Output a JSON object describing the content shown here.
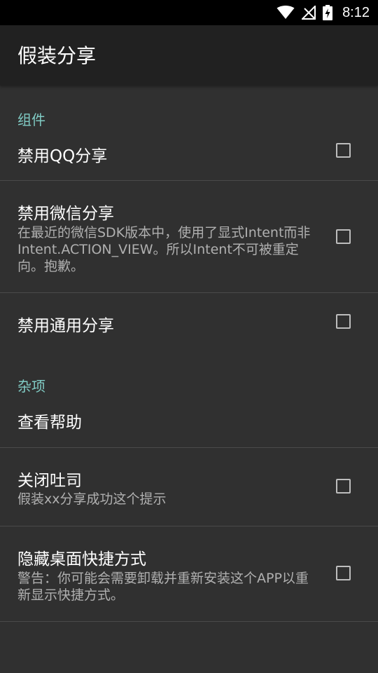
{
  "status_bar": {
    "time": "8:12",
    "icons": [
      "wifi-icon",
      "no-signal-icon",
      "battery-charging-icon"
    ]
  },
  "toolbar": {
    "title": "假装分享"
  },
  "colors": {
    "background": "#303030",
    "toolbar": "#212121",
    "accent": "#80cbc4",
    "divider": "#4a4a4a"
  },
  "categories": [
    {
      "title": "组件",
      "items": [
        {
          "title": "禁用QQ分享",
          "summary": "",
          "checkbox": true,
          "checked": false
        },
        {
          "title": "禁用微信分享",
          "summary": "在最近的微信SDK版本中，使用了显式Intent而非Intent.ACTION_VIEW。所以Intent不可被重定向。抱歉。",
          "checkbox": true,
          "checked": false
        },
        {
          "title": "禁用通用分享",
          "summary": "",
          "checkbox": true,
          "checked": false
        }
      ]
    },
    {
      "title": "杂项",
      "items": [
        {
          "title": "查看帮助",
          "summary": "",
          "checkbox": false
        },
        {
          "title": "关闭吐司",
          "summary": "假装xx分享成功这个提示",
          "checkbox": true,
          "checked": false
        },
        {
          "title": "隐藏桌面快捷方式",
          "summary": "警告：你可能会需要卸载并重新安装这个APP以重新显示快捷方式。",
          "checkbox": true,
          "checked": false
        }
      ]
    }
  ]
}
